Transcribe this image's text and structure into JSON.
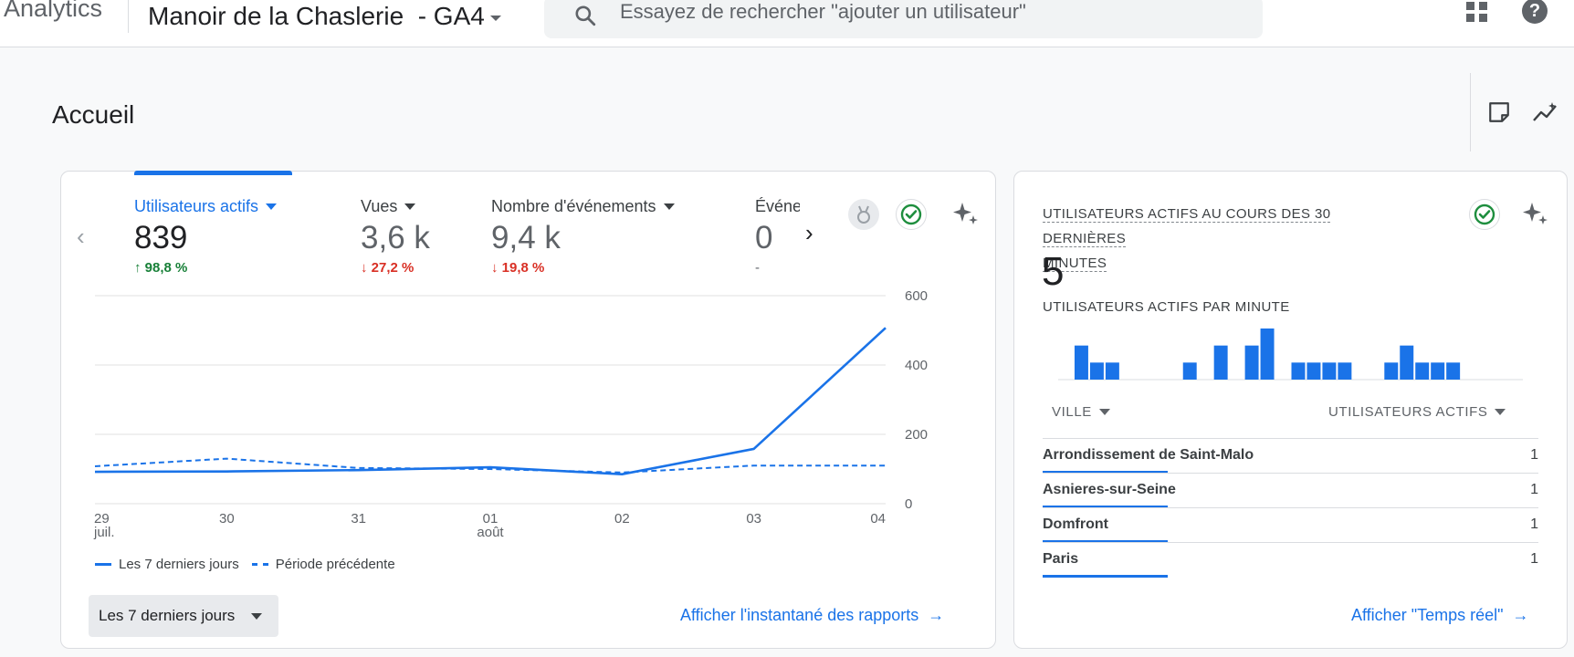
{
  "header": {
    "brand": "Analytics",
    "property": "Manoir de la Chaslerie  - GA4",
    "search_placeholder": "Essayez de rechercher \"ajouter un utilisateur\""
  },
  "page": {
    "title": "Accueil"
  },
  "summary_card": {
    "metrics": [
      {
        "label": "Utilisateurs actifs",
        "value": "839",
        "change": "98,8 %",
        "direction": "up"
      },
      {
        "label": "Vues",
        "value": "3,6 k",
        "change": "27,2 %",
        "direction": "down"
      },
      {
        "label": "Nombre d'événements",
        "value": "9,4 k",
        "change": "19,8 %",
        "direction": "down"
      },
      {
        "label": "Événe",
        "value": "0",
        "change": "-",
        "direction": "none"
      }
    ],
    "legend": {
      "current": "Les 7 derniers jours",
      "previous": "Période précédente"
    },
    "date_range_button": "Les 7 derniers jours",
    "report_link": "Afficher l'instantané des rapports"
  },
  "chart_data": {
    "type": "line",
    "x": [
      "29 juil.",
      "30",
      "31",
      "01 août",
      "02",
      "03",
      "04"
    ],
    "x_tick_labels": [
      [
        "29",
        "juil."
      ],
      [
        "30"
      ],
      [
        "31"
      ],
      [
        "01",
        "août"
      ],
      [
        "02"
      ],
      [
        "03"
      ],
      [
        "04"
      ]
    ],
    "ylim": [
      0,
      600
    ],
    "y_ticks": [
      "0",
      "200",
      "400",
      "600"
    ],
    "y_axis_position": "right",
    "grid": true,
    "series": [
      {
        "name": "Les 7 derniers jours",
        "style": "solid",
        "color": "#1a73e8",
        "values": [
          92,
          93,
          97,
          105,
          85,
          158,
          507
        ]
      },
      {
        "name": "Période précédente",
        "style": "dashed",
        "color": "#1a73e8",
        "values": [
          108,
          130,
          103,
          100,
          90,
          110,
          110
        ]
      }
    ]
  },
  "realtime_card": {
    "title": [
      "UTILISATEURS ACTIFS AU COURS DES 30 DERNIÈRES",
      "MINUTES"
    ],
    "value": "5",
    "subtitle": "UTILISATEURS ACTIFS PAR MINUTE",
    "per_minute_bars": [
      0,
      2,
      1,
      1,
      0,
      0,
      0,
      0,
      1,
      0,
      2,
      0,
      2,
      3,
      0,
      1,
      1,
      1,
      1,
      0,
      0,
      1,
      2,
      1,
      1,
      1,
      0,
      0,
      0,
      0
    ],
    "table": {
      "col_city": "VILLE",
      "col_users": "UTILISATEURS ACTIFS",
      "rows": [
        {
          "city": "Arrondissement de Saint-Malo",
          "users": "1"
        },
        {
          "city": "Asnieres-sur-Seine",
          "users": "1"
        },
        {
          "city": "Domfront",
          "users": "1"
        },
        {
          "city": "Paris",
          "users": "1"
        }
      ]
    },
    "link": "Afficher \"Temps réel\""
  },
  "colors": {
    "accent": "#1a73e8",
    "up": "#188038",
    "down": "#d93025",
    "success": "#1e8e3e"
  }
}
